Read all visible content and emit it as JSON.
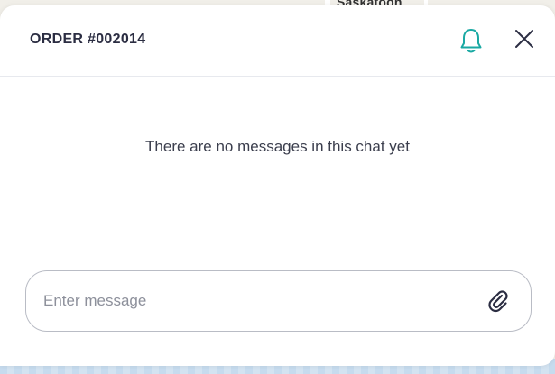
{
  "map": {
    "city_label": "Saskatoon"
  },
  "chat": {
    "order_title": "ORDER #002014",
    "empty_state": "There are no messages in this chat yet",
    "composer": {
      "value": "",
      "placeholder": "Enter message"
    }
  },
  "icons": {
    "bell": "bell-icon",
    "close": "close-icon",
    "attach": "paperclip-icon"
  },
  "colors": {
    "accent": "#1aa9a3",
    "title_text": "#2b2d42",
    "body_text": "#3b3e4d",
    "placeholder": "#8d909b",
    "border": "#b9bcc5"
  }
}
